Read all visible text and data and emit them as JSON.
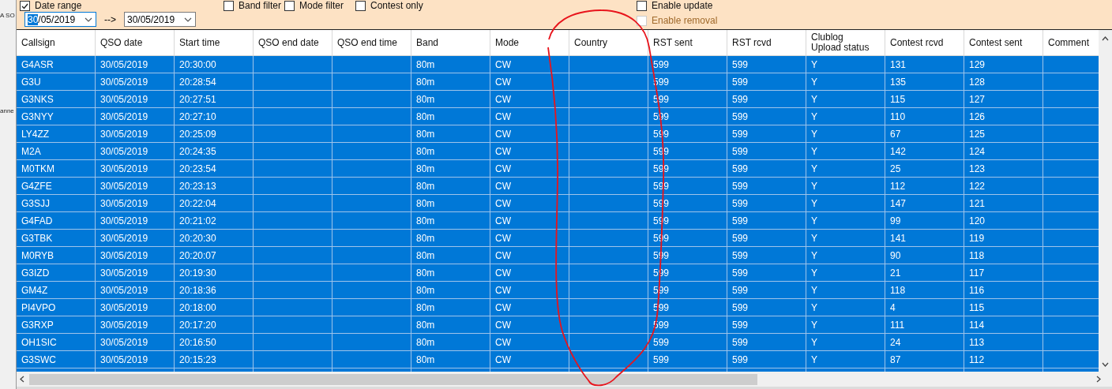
{
  "side_window": {
    "texts": [
      "A SO",
      "anne"
    ]
  },
  "filters": {
    "top_checkboxes": [
      {
        "label": "Date range",
        "checked": true,
        "disabled": false
      },
      {
        "label": "Band filter",
        "checked": false,
        "disabled": false
      },
      {
        "label": "Mode filter",
        "checked": false,
        "disabled": false
      },
      {
        "label": "Contest only",
        "checked": false,
        "disabled": false
      }
    ],
    "right_checkboxes": [
      {
        "label": "Enable update",
        "checked": false,
        "disabled": false
      },
      {
        "label": "Enable removal",
        "checked": false,
        "disabled": true
      }
    ],
    "date_from": {
      "value_parts": [
        {
          "text": "30",
          "selected": true
        },
        {
          "text": "/05/2019",
          "selected": false
        }
      ]
    },
    "range_arrow": "-->",
    "date_to": {
      "value_parts": [
        {
          "text": "30/05/2019",
          "selected": false
        }
      ]
    }
  },
  "table": {
    "columns": [
      "Callsign",
      "QSO date",
      "Start time",
      "QSO end date",
      "QSO end time",
      "Band",
      "Mode",
      "Country",
      "RST sent",
      "RST rcvd",
      "Clublog\nUpload status",
      "Contest rcvd",
      "Contest sent",
      "Comment"
    ],
    "rows": [
      {
        "selected": true,
        "cells": [
          "G4ASR",
          "30/05/2019",
          "20:30:00",
          "",
          "",
          "80m",
          "CW",
          "",
          "599",
          "599",
          "Y",
          "131",
          "129",
          ""
        ]
      },
      {
        "selected": true,
        "cells": [
          "G3U",
          "30/05/2019",
          "20:28:54",
          "",
          "",
          "80m",
          "CW",
          "",
          "599",
          "599",
          "Y",
          "135",
          "128",
          ""
        ]
      },
      {
        "selected": true,
        "cells": [
          "G3NKS",
          "30/05/2019",
          "20:27:51",
          "",
          "",
          "80m",
          "CW",
          "",
          "599",
          "599",
          "Y",
          "115",
          "127",
          ""
        ]
      },
      {
        "selected": true,
        "cells": [
          "G3NYY",
          "30/05/2019",
          "20:27:10",
          "",
          "",
          "80m",
          "CW",
          "",
          "599",
          "599",
          "Y",
          "110",
          "126",
          ""
        ]
      },
      {
        "selected": true,
        "cells": [
          "LY4ZZ",
          "30/05/2019",
          "20:25:09",
          "",
          "",
          "80m",
          "CW",
          "",
          "599",
          "599",
          "Y",
          "67",
          "125",
          ""
        ]
      },
      {
        "selected": true,
        "cells": [
          "M2A",
          "30/05/2019",
          "20:24:35",
          "",
          "",
          "80m",
          "CW",
          "",
          "599",
          "599",
          "Y",
          "142",
          "124",
          ""
        ]
      },
      {
        "selected": true,
        "cells": [
          "M0TKM",
          "30/05/2019",
          "20:23:54",
          "",
          "",
          "80m",
          "CW",
          "",
          "599",
          "599",
          "Y",
          "25",
          "123",
          ""
        ]
      },
      {
        "selected": true,
        "cells": [
          "G4ZFE",
          "30/05/2019",
          "20:23:13",
          "",
          "",
          "80m",
          "CW",
          "",
          "599",
          "599",
          "Y",
          "112",
          "122",
          ""
        ]
      },
      {
        "selected": true,
        "cells": [
          "G3SJJ",
          "30/05/2019",
          "20:22:04",
          "",
          "",
          "80m",
          "CW",
          "",
          "599",
          "599",
          "Y",
          "147",
          "121",
          ""
        ]
      },
      {
        "selected": true,
        "cells": [
          "G4FAD",
          "30/05/2019",
          "20:21:02",
          "",
          "",
          "80m",
          "CW",
          "",
          "599",
          "599",
          "Y",
          "99",
          "120",
          ""
        ]
      },
      {
        "selected": true,
        "cells": [
          "G3TBK",
          "30/05/2019",
          "20:20:30",
          "",
          "",
          "80m",
          "CW",
          "",
          "599",
          "599",
          "Y",
          "141",
          "119",
          ""
        ]
      },
      {
        "selected": true,
        "cells": [
          "M0RYB",
          "30/05/2019",
          "20:20:07",
          "",
          "",
          "80m",
          "CW",
          "",
          "599",
          "599",
          "Y",
          "90",
          "118",
          ""
        ]
      },
      {
        "selected": true,
        "cells": [
          "G3IZD",
          "30/05/2019",
          "20:19:30",
          "",
          "",
          "80m",
          "CW",
          "",
          "599",
          "599",
          "Y",
          "21",
          "117",
          ""
        ]
      },
      {
        "selected": true,
        "cells": [
          "GM4Z",
          "30/05/2019",
          "20:18:36",
          "",
          "",
          "80m",
          "CW",
          "",
          "599",
          "599",
          "Y",
          "118",
          "116",
          ""
        ]
      },
      {
        "selected": true,
        "cells": [
          "PI4VPO",
          "30/05/2019",
          "20:18:00",
          "",
          "",
          "80m",
          "CW",
          "",
          "599",
          "599",
          "Y",
          "4",
          "115",
          ""
        ]
      },
      {
        "selected": true,
        "cells": [
          "G3RXP",
          "30/05/2019",
          "20:17:20",
          "",
          "",
          "80m",
          "CW",
          "",
          "599",
          "599",
          "Y",
          "111",
          "114",
          ""
        ]
      },
      {
        "selected": true,
        "cells": [
          "OH1SIC",
          "30/05/2019",
          "20:16:50",
          "",
          "",
          "80m",
          "CW",
          "",
          "599",
          "599",
          "Y",
          "24",
          "113",
          ""
        ]
      },
      {
        "selected": true,
        "cells": [
          "G3SWC",
          "30/05/2019",
          "20:15:23",
          "",
          "",
          "80m",
          "CW",
          "",
          "599",
          "599",
          "Y",
          "87",
          "112",
          ""
        ]
      }
    ]
  },
  "annotation": {
    "kind": "freehand-loop"
  }
}
